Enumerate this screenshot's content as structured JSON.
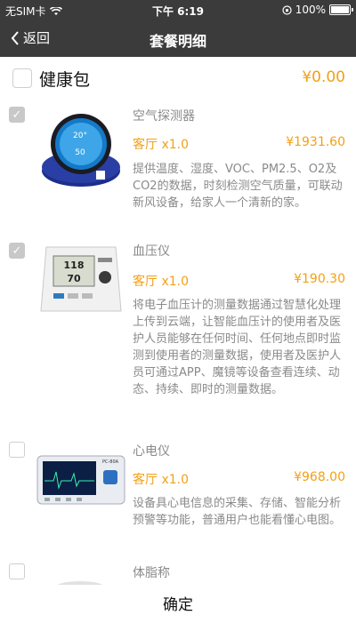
{
  "status": {
    "carrier": "无SIM卡",
    "time": "下午 6:19",
    "battery": "100%",
    "battery_level": 1.0
  },
  "nav": {
    "back_label": "返回",
    "title": "套餐明细"
  },
  "package": {
    "name": "健康包",
    "price": "¥0.00",
    "checked": false
  },
  "items": [
    {
      "name": "空气探测器",
      "qty": "客厅 x1.0",
      "price": "¥1931.60",
      "checked": true,
      "desc": "提供温度、湿度、VOC、PM2.5、O2及CO2的数据，时刻检测空气质量，可联动新风设备，给家人一个清新的家。",
      "icon": "air-detector-icon"
    },
    {
      "name": "血压仪",
      "qty": "客厅 x1.0",
      "price": "¥190.30",
      "checked": true,
      "desc": "将电子血压计的测量数据通过智慧化处理上传到云端，让智能血压计的使用者及医护人员能够在任何时间、任何地点即时监测到使用者的测量数据，使用者及医护人员可通过APP、魔镜等设备查看连续、动态、持续、即时的测量数据。",
      "icon": "blood-pressure-monitor-icon"
    },
    {
      "name": "心电仪",
      "qty": "客厅 x1.0",
      "price": "¥968.00",
      "checked": false,
      "desc": "设备具心电信息的采集、存储、智能分析预警等功能，普通用户也能看懂心电图。",
      "icon": "ecg-monitor-icon"
    },
    {
      "name": "体脂称",
      "checked": false,
      "icon": "body-fat-scale-icon"
    }
  ],
  "device_screens": {
    "air_temp": "20°",
    "air_humidity": "50",
    "bp_sys": "118",
    "bp_dia": "70",
    "ecg_brand": "PC-80A"
  },
  "footer": {
    "confirm_label": "确定"
  },
  "colors": {
    "bar": "#3b3b3b",
    "accent": "#f3a015",
    "muted_text": "#8a8a8a"
  }
}
